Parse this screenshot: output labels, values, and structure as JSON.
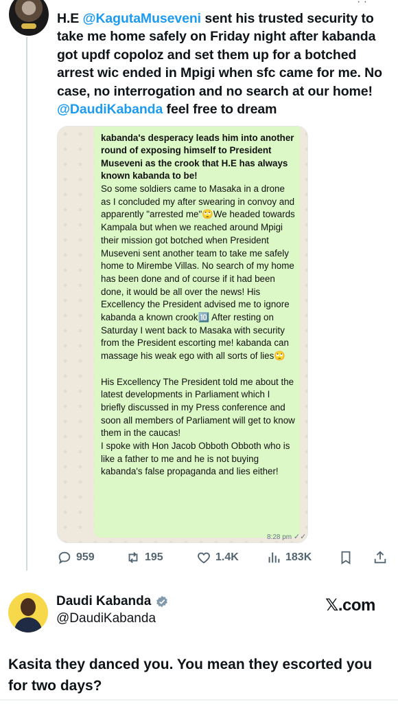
{
  "tweet": {
    "text_prefix": "H.E ",
    "mention_1": "@KagutaMuseveni",
    "text_middle": " sent his trusted security to take me home safely on Friday night after kabanda got updf copoloz and set them up for a botched arrest wic ended in Mpigi when sfc came for me. No case, no interrogation and no search at our home! ",
    "mention_2": "@DaudiKabanda",
    "text_suffix": " feel free to dream"
  },
  "chat_screenshot": {
    "bold_text": "kabanda's desperacy leads him into another round of exposing himself to President Museveni as the crook that H.E has always known kabanda to be!",
    "body_text": "So some soldiers came to Masaka in a drone as I concluded my after swearing in convoy and apparently \"arrested me\"🙄We headed towards Kampala but when we reached around Mpigi their mission got botched when President Museveni sent another team to take me safely home to Mirembe Villas. No search of my home has been done and of course if it had been done, it would be all over the news! His Excellency the President advised me to ignore kabanda a known crook🔟 After resting on Saturday I went back to Masaka with security from the President escorting me! kabanda can massage his weak ego with all sorts of lies🙄\n\nHis Excellency The President told me about the latest developments in Parliament which I briefly discussed in my Press conference and soon all members of Parliament will get to know them in the caucas!\nI spoke with Hon Jacob Obboth Obboth who is like a father to me and he is not buying kabanda's false propaganda and lies either!",
    "time": "8:28 pm",
    "read_ticks": "✓✓"
  },
  "actions": {
    "replies": "959",
    "reposts": "195",
    "likes": "1.4K",
    "views": "183K"
  },
  "quote": {
    "name": "Daudi Kabanda",
    "handle": "@DaudiKabanda",
    "brand_glyph": "𝕏",
    "brand_text": ".com",
    "text": "Kasita they danced you. You mean they escorted you for two days?"
  },
  "colors": {
    "link": "#1d9bf0",
    "bubble": "#dcf8c6",
    "muted": "#536471"
  }
}
